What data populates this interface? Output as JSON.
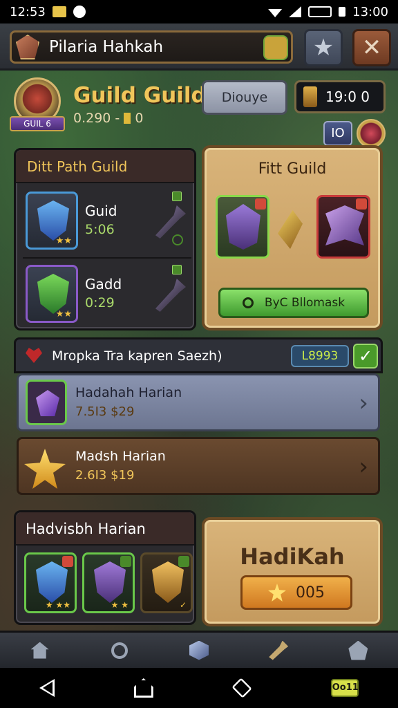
{
  "status_bar": {
    "time_left": "12:53",
    "time_right": "13:00"
  },
  "header": {
    "title": "Pilaria Hahkah",
    "star_button": "★",
    "close_button": "✕"
  },
  "guild": {
    "name": "Guild Guild",
    "sub_value": "0.290 -",
    "sub_suffix": "0",
    "emblem_label": "GUIL 6",
    "badge_button": "Diouye",
    "counter": "19:0 0",
    "small_chip": "IO"
  },
  "left_panel": {
    "title": "Ditt Path Guild",
    "rows": [
      {
        "name": "Guid",
        "value": "5:06",
        "stars": "★★"
      },
      {
        "name": "Gadd",
        "value": "0:29",
        "stars": "★★"
      }
    ]
  },
  "right_panel": {
    "title": "Fitt Guild",
    "button_label": "ByC Bllomask"
  },
  "mission": {
    "title": "Mropka Tra kapren Saezh)",
    "code": "L8993",
    "check": "✓",
    "tasks": [
      {
        "name": "Hadahah Harian",
        "value": "7.5I3 $29",
        "arrow": "›"
      },
      {
        "name": "Madsh Harian",
        "value": "2.6I3 $19",
        "arrow": "›"
      }
    ]
  },
  "rewards": {
    "title": "Hadvisbh Harian",
    "items": [
      {
        "stars": "★ ★★"
      },
      {
        "stars": "★ ★"
      },
      {
        "stars": "✓"
      }
    ]
  },
  "claim": {
    "title": "HadiKah",
    "button_value": "005"
  },
  "nav": {
    "chip": "Oo11"
  },
  "colors": {
    "accent_gold": "#f0c55a",
    "panel_tan": "#d9b47a",
    "green_button": "#8ae06a",
    "orange_button": "#f0b04a"
  }
}
